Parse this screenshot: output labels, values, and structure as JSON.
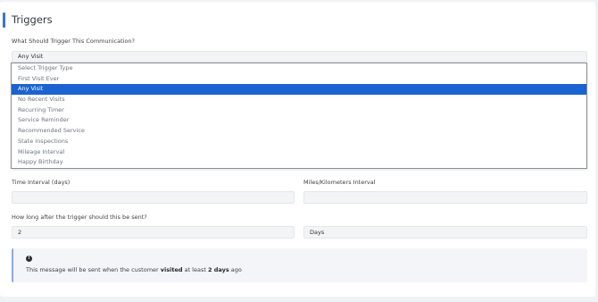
{
  "section": {
    "title": "Triggers"
  },
  "trigger": {
    "question": "What Should Trigger This Communication?",
    "selected": "Any Visit",
    "options": [
      "Select Trigger Type",
      "First Visit Ever",
      "Any Visit",
      "No Recent Visits",
      "Recurring Timer",
      "Service Reminder",
      "Recommended Service",
      "State Inspections",
      "Mileage Interval",
      "Happy Birthday"
    ],
    "selected_index": 2
  },
  "interval": {
    "time_label": "Time Interval (days)",
    "time_value": "",
    "miles_label": "Miles/Kilometers Interval",
    "miles_value": ""
  },
  "delay": {
    "question": "How long after the trigger should this be sent?",
    "amount": "2",
    "unit": "Days"
  },
  "info": {
    "icon": "info-circle-icon",
    "pre": "This message will be sent when the customer ",
    "bold1": "visited",
    "mid": " at least ",
    "bold2": "2 days",
    "post": " ago"
  },
  "colors": {
    "accent": "#3b73d9",
    "selected_option": "#1a63d0"
  }
}
